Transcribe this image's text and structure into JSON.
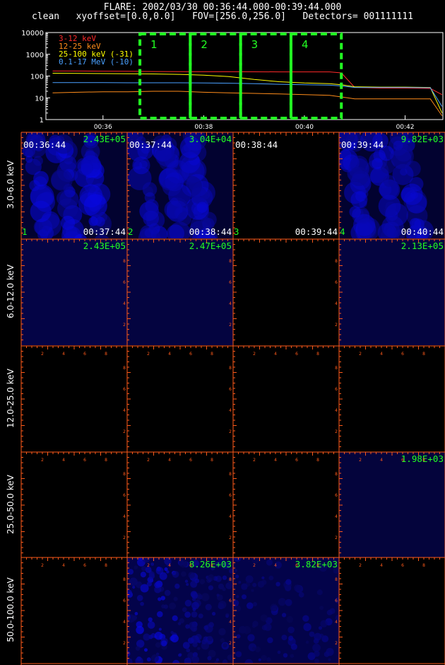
{
  "header": {
    "line1": "FLARE: 2002/03/30 00:36:44.000-00:39:44.000",
    "line2": "clean   xyoffset=[0.0,0.0]   FOV=[256.0,256.0]   Detectors= 001111111"
  },
  "chart_data": [
    {
      "type": "line",
      "x": [
        "00:35:00",
        "00:35:30",
        "00:36:00",
        "00:36:30",
        "00:37:00",
        "00:37:30",
        "00:38:00",
        "00:38:30",
        "00:39:00",
        "00:39:30",
        "00:40:00",
        "00:40:30",
        "00:40:44",
        "00:41:00",
        "00:41:30",
        "00:42:00",
        "00:42:30",
        "00:42:44"
      ],
      "series": [
        {
          "name": "3-12 keV",
          "color": "#ff2a2a",
          "values": [
            170,
            170,
            168,
            165,
            162,
            160,
            158,
            158,
            157,
            156,
            156,
            155,
            140,
            30,
            28,
            28,
            27,
            14
          ]
        },
        {
          "name": "12-25 keV",
          "color": "#ff8c1a",
          "values": [
            17,
            18,
            19,
            19,
            20,
            20,
            18,
            17,
            16,
            15,
            14,
            13,
            11,
            9,
            9,
            9,
            9,
            1.5
          ]
        },
        {
          "name": "25-100 keV (-31)",
          "color": "#ffff00",
          "values": [
            135,
            133,
            130,
            128,
            125,
            120,
            110,
            95,
            70,
            55,
            48,
            45,
            40,
            32,
            31,
            31,
            30,
            2
          ]
        },
        {
          "name": "0.1-17 MeV (-10)",
          "color": "#4aa0ff",
          "values": [
            50,
            50,
            50,
            49,
            49,
            49,
            48,
            47,
            45,
            42,
            40,
            38,
            35,
            30,
            30,
            30,
            29,
            4
          ]
        }
      ],
      "xticks": [
        "00:36",
        "00:38",
        "00:40",
        "00:42"
      ],
      "yscale": "log",
      "yticks": [
        "1",
        "10",
        "100",
        "1000",
        "10000"
      ],
      "ylim": [
        1,
        10000
      ],
      "intervals": [
        {
          "label": "1",
          "start": "00:36:44",
          "end": "00:37:44"
        },
        {
          "label": "2",
          "start": "00:37:44",
          "end": "00:38:44"
        },
        {
          "label": "3",
          "start": "00:38:44",
          "end": "00:39:44"
        },
        {
          "label": "4",
          "start": "00:39:44",
          "end": "00:40:44"
        }
      ],
      "interval_color": "#22ff22"
    },
    {
      "type": "heatmap",
      "rows": [
        "3.0-6.0 keV",
        "6.0-12.0 keV",
        "12.0-25.0 keV",
        "25.0-50.0 keV",
        "50.0-100.0 keV"
      ],
      "cols": [
        "1",
        "2",
        "3",
        "4"
      ],
      "axis_ticks": [
        "2",
        "4",
        "6",
        "8"
      ],
      "panels": [
        {
          "row": 0,
          "col": 0,
          "max": "2.43E+05",
          "start": "00:36:44",
          "end": "00:37:44",
          "interval": "1",
          "intensity": 0.9,
          "pattern": "streaks"
        },
        {
          "row": 0,
          "col": 1,
          "max": "3.04E+04",
          "start": "00:37:44",
          "end": "00:38:44",
          "interval": "2",
          "intensity": 0.85,
          "pattern": "streaks"
        },
        {
          "row": 0,
          "col": 2,
          "max": "",
          "start": "00:38:44",
          "end": "00:39:44",
          "interval": "3",
          "intensity": 0,
          "pattern": "none"
        },
        {
          "row": 0,
          "col": 3,
          "max": "9.82E+03",
          "start": "00:39:44",
          "end": "00:40:44",
          "interval": "4",
          "intensity": 0.85,
          "pattern": "streaks"
        },
        {
          "row": 1,
          "col": 0,
          "max": "2.43E+05",
          "intensity": 0.15,
          "pattern": "faint"
        },
        {
          "row": 1,
          "col": 1,
          "max": "2.47E+05",
          "intensity": 0.12,
          "pattern": "faint"
        },
        {
          "row": 1,
          "col": 2,
          "max": "",
          "intensity": 0,
          "pattern": "none"
        },
        {
          "row": 1,
          "col": 3,
          "max": "2.13E+05",
          "intensity": 0.12,
          "pattern": "faint"
        },
        {
          "row": 2,
          "col": 0,
          "max": "",
          "intensity": 0,
          "pattern": "none"
        },
        {
          "row": 2,
          "col": 1,
          "max": "",
          "intensity": 0,
          "pattern": "none"
        },
        {
          "row": 2,
          "col": 2,
          "max": "",
          "intensity": 0,
          "pattern": "none"
        },
        {
          "row": 2,
          "col": 3,
          "max": "",
          "intensity": 0,
          "pattern": "none"
        },
        {
          "row": 3,
          "col": 0,
          "max": "",
          "intensity": 0,
          "pattern": "none"
        },
        {
          "row": 3,
          "col": 1,
          "max": "",
          "intensity": 0,
          "pattern": "none"
        },
        {
          "row": 3,
          "col": 2,
          "max": "",
          "intensity": 0,
          "pattern": "none"
        },
        {
          "row": 3,
          "col": 3,
          "max": "1.98E+03",
          "intensity": 0.1,
          "pattern": "faint"
        },
        {
          "row": 4,
          "col": 0,
          "max": "",
          "intensity": 0,
          "pattern": "none"
        },
        {
          "row": 4,
          "col": 1,
          "max": "8.26E+03",
          "intensity": 0.55,
          "pattern": "speckle"
        },
        {
          "row": 4,
          "col": 2,
          "max": "3.82E+03",
          "intensity": 0.35,
          "pattern": "speckle"
        },
        {
          "row": 4,
          "col": 3,
          "max": "",
          "intensity": 0,
          "pattern": "none"
        }
      ],
      "max_color": "#22ff22",
      "axis_color": "#ff5a1a",
      "time_color": "#ffffff"
    }
  ]
}
